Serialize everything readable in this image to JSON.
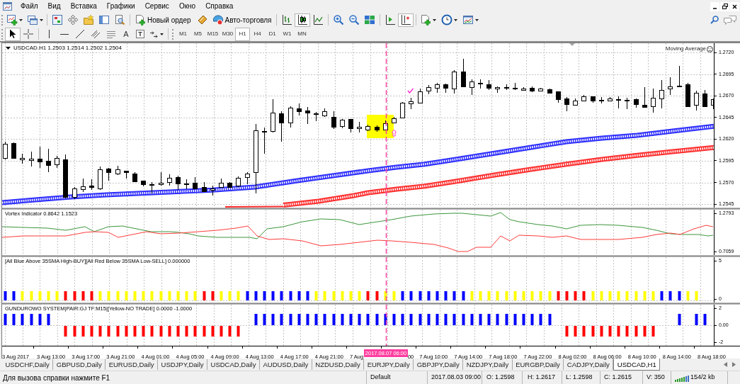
{
  "menu": {
    "items": [
      "Файл",
      "Вид",
      "Вставка",
      "Графики",
      "Сервис",
      "Окно",
      "Справка"
    ]
  },
  "toolbar": {
    "new_order": "Новый ордер",
    "autotrading": "Авто-торговля",
    "chart_types": [
      {
        "kind": "bars",
        "selected": false
      },
      {
        "kind": "candles",
        "selected": true
      },
      {
        "kind": "line",
        "selected": false
      }
    ],
    "scroll_toggles": [
      {
        "kind": "autoscroll",
        "on": false
      },
      {
        "kind": "shift",
        "on": true
      }
    ]
  },
  "drawing_toolbar": {
    "tools": [
      {
        "kind": "cursor",
        "selected": true
      },
      {
        "kind": "crosshair",
        "selected": false
      },
      {
        "kind": "vline",
        "selected": false
      },
      {
        "kind": "hline",
        "selected": false
      },
      {
        "kind": "trendline",
        "selected": false
      },
      {
        "kind": "channel",
        "selected": false
      },
      {
        "kind": "fibo",
        "selected": false
      },
      {
        "kind": "text",
        "glyph": "A",
        "selected": false
      },
      {
        "kind": "label",
        "glyph": "T",
        "selected": false
      },
      {
        "kind": "arrows",
        "selected": false
      }
    ],
    "periods": [
      {
        "label": "M1",
        "selected": false
      },
      {
        "label": "M5",
        "selected": false
      },
      {
        "label": "M15",
        "selected": false
      },
      {
        "label": "M30",
        "selected": false
      },
      {
        "label": "H1",
        "selected": true
      },
      {
        "label": "H4",
        "selected": false
      },
      {
        "label": "D1",
        "selected": false
      },
      {
        "label": "W1",
        "selected": false
      },
      {
        "label": "MN",
        "selected": false
      }
    ]
  },
  "chart": {
    "title": "USDCAD.H1 1.2503 1.2514 1.2502 1.2504",
    "expert": "Moving Average",
    "price_axis": [
      "1.2720",
      "1.2695",
      "1.2670",
      "1.2645",
      "1.2620",
      "1.2595",
      "1.2570",
      "1.2545"
    ],
    "panels": [
      {
        "kind": "vortex",
        "label": "Vortex Indicator 0.8642 1.1523",
        "axis": [
          "1.2793",
          "0.7059"
        ]
      },
      {
        "kind": "signal",
        "label": "[All Blue Above 35SMA High-BUY][All Red Below 35SMA Low-SELL] 0.000000",
        "axis": [
          "5",
          "0"
        ]
      },
      {
        "kind": "gundurowo",
        "label": "GUNDUROWO SYSTEM|PAIR:GJ TF:M15|[Yellow-NO TRADE] 0.0000 -1.0000",
        "axis": [
          "2",
          "0.00",
          "-2"
        ]
      }
    ],
    "time_axis": {
      "labels": [
        "3 Aug 2017",
        "3 Aug 13:00",
        "3 Aug 17:00",
        "3 Aug 21:00",
        "4 Aug 01:00",
        "4 Aug 05:00",
        "4 Aug 09:00",
        "4 Aug 13:00",
        "4 Aug 17:00",
        "4 Aug 21:00",
        "7 Aug",
        "00",
        "7 Aug 10:00",
        "7 Aug 14:00",
        "7 Aug 18:00",
        "7 Aug 22:00",
        "8 Aug 02:00",
        "8 Aug 06:00",
        "8 Aug 10:00",
        "8 Aug 14:00",
        "8 Aug 18:00"
      ],
      "cursor_label": "2017.08.07 06:00"
    }
  },
  "tabs": [
    {
      "label": "USDCHF,Daily",
      "selected": false
    },
    {
      "label": "GBPUSD,Daily",
      "selected": false
    },
    {
      "label": "EURUSD,Daily",
      "selected": false
    },
    {
      "label": "USDJPY,Daily",
      "selected": false
    },
    {
      "label": "USDCAD,Daily",
      "selected": false
    },
    {
      "label": "AUDUSD,Daily",
      "selected": false
    },
    {
      "label": "NZDUSD,Daily",
      "selected": false
    },
    {
      "label": "EURJPY,Daily",
      "selected": false
    },
    {
      "label": "GBPJPY,Daily",
      "selected": false
    },
    {
      "label": "NZDJPY,Daily",
      "selected": false
    },
    {
      "label": "EURGBP,Daily",
      "selected": false
    },
    {
      "label": "CADJPY,Daily",
      "selected": false
    },
    {
      "label": "USDCAD,H1",
      "selected": true
    }
  ],
  "status_bar": {
    "hint": "Для вызова справки нажмите F1",
    "profile": "Default",
    "datetime": "2017.08.03 09:00",
    "open": "O: 1.2598",
    "high": "H: 1.2617",
    "low": "L: 1.2598",
    "close": "C: 1.2615",
    "volume": "V: 350",
    "traffic": "154/2 kb"
  }
}
